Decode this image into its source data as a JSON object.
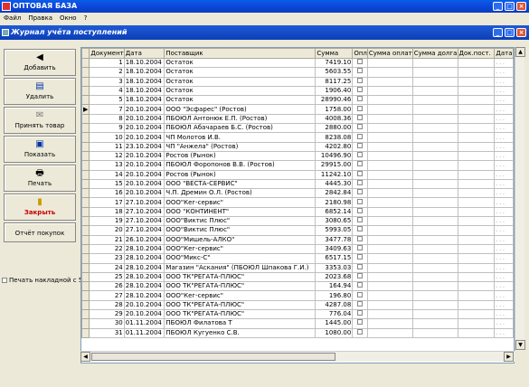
{
  "app": {
    "title": "ОПТОВАЯ БАЗА"
  },
  "menu": [
    "Файл",
    "Правка",
    "Окно",
    "?"
  ],
  "window": {
    "title": "Журнал учёта поступлений"
  },
  "sidebar": {
    "add": "Добавить",
    "delete": "Удалить",
    "accept": "Принять товар",
    "show": "Показать",
    "print": "Печать",
    "close": "Закрыть",
    "report": "Отчёт покупок",
    "print_invoice": "Печать накладной с 5%"
  },
  "columns": [
    "Документ",
    "Дата",
    "Поставщик",
    "Сумма",
    "Опл",
    "Сумма оплат",
    "Сумма долга",
    "Док.пост.",
    "Дата"
  ],
  "rows": [
    {
      "n": "1",
      "date": "18.10.2004",
      "supplier": "Остаток",
      "sum": "7419.10"
    },
    {
      "n": "2",
      "date": "18.10.2004",
      "supplier": "Остаток",
      "sum": "5603.55"
    },
    {
      "n": "3",
      "date": "18.10.2004",
      "supplier": "Остаток",
      "sum": "8117.25"
    },
    {
      "n": "4",
      "date": "18.10.2004",
      "supplier": "Остаток",
      "sum": "1906.40"
    },
    {
      "n": "5",
      "date": "18.10.2004",
      "supplier": "Остаток",
      "sum": "28990.46"
    },
    {
      "n": "7",
      "date": "20.10.2004",
      "supplier": "ООО \"Эсфарес\" (Ростов)",
      "sum": "1758.00"
    },
    {
      "n": "8",
      "date": "20.10.2004",
      "supplier": "ПБОЮЛ Антонюк Е.П. (Ростов)",
      "sum": "4008.36"
    },
    {
      "n": "9",
      "date": "20.10.2004",
      "supplier": "ПБОЮЛ Абачараев Б.С. (Ростов)",
      "sum": "2880.00"
    },
    {
      "n": "10",
      "date": "20.10.2004",
      "supplier": "ЧП Молотов И.В.",
      "sum": "8238.08"
    },
    {
      "n": "11",
      "date": "23.10.2004",
      "supplier": "ЧП \"Анжела\" (Ростов)",
      "sum": "4202.80"
    },
    {
      "n": "12",
      "date": "20.10.2004",
      "supplier": "Ростов (Рынок)",
      "sum": "10496.90"
    },
    {
      "n": "13",
      "date": "20.10.2004",
      "supplier": "ПБОЮЛ Форопонов В.В. (Ростов)",
      "sum": "29915.00"
    },
    {
      "n": "14",
      "date": "20.10.2004",
      "supplier": "Ростов (Рынок)",
      "sum": "11242.10"
    },
    {
      "n": "15",
      "date": "20.10.2004",
      "supplier": "ООО \"ВЕСТА-СЕРВИС\"",
      "sum": "4445.30"
    },
    {
      "n": "16",
      "date": "20.10.2004",
      "supplier": "Ч.П. Дремин О.Л. (Ростов)",
      "sum": "2842.84"
    },
    {
      "n": "17",
      "date": "27.10.2004",
      "supplier": "ООО\"Кег-сервис\"",
      "sum": "2180.98"
    },
    {
      "n": "18",
      "date": "27.10.2004",
      "supplier": "ООО \"КОНТИНЕНТ\"",
      "sum": "6852.14"
    },
    {
      "n": "19",
      "date": "27.10.2004",
      "supplier": "ООО\"Виктис Плюс\"",
      "sum": "3080.65"
    },
    {
      "n": "20",
      "date": "27.10.2004",
      "supplier": "ООО\"Виктис Плюс\"",
      "sum": "5993.05"
    },
    {
      "n": "21",
      "date": "26.10.2004",
      "supplier": "ООО\"Мишель-АЛКО\"",
      "sum": "3477.78"
    },
    {
      "n": "22",
      "date": "28.10.2004",
      "supplier": "ООО\"Кег-сервис\"",
      "sum": "3409.63"
    },
    {
      "n": "23",
      "date": "28.10.2004",
      "supplier": "ООО\"Микс-С\"",
      "sum": "6517.15"
    },
    {
      "n": "24",
      "date": "28.10.2004",
      "supplier": "Магазин \"Аскания\" (ПБОЮЛ Шпакова Г.И.)",
      "sum": "3353.03"
    },
    {
      "n": "25",
      "date": "28.10.2004",
      "supplier": "ООО ТК\"РЕГАТА-ПЛЮС\"",
      "sum": "2023.68"
    },
    {
      "n": "26",
      "date": "28.10.2004",
      "supplier": "ООО ТК\"РЕГАТА-ПЛЮС\"",
      "sum": "164.94"
    },
    {
      "n": "27",
      "date": "28.10.2004",
      "supplier": "ООО\"Кег-сервис\"",
      "sum": "196.80"
    },
    {
      "n": "28",
      "date": "20.10.2004",
      "supplier": "ООО ТК\"РЕГАТА-ПЛЮС\"",
      "sum": "4287.08"
    },
    {
      "n": "29",
      "date": "20.10.2004",
      "supplier": "ООО ТК\"РЕГАТА-ПЛЮС\"",
      "sum": "776.04"
    },
    {
      "n": "30",
      "date": "01.11.2004",
      "supplier": "ПБОЮЛ Филатова Т",
      "sum": "1445.00"
    },
    {
      "n": "31",
      "date": "01.11.2004",
      "supplier": "ПБОЮЛ Кугуенко С.В.",
      "sum": "1080.00"
    }
  ],
  "current_row": 5,
  "dots": ". . ."
}
